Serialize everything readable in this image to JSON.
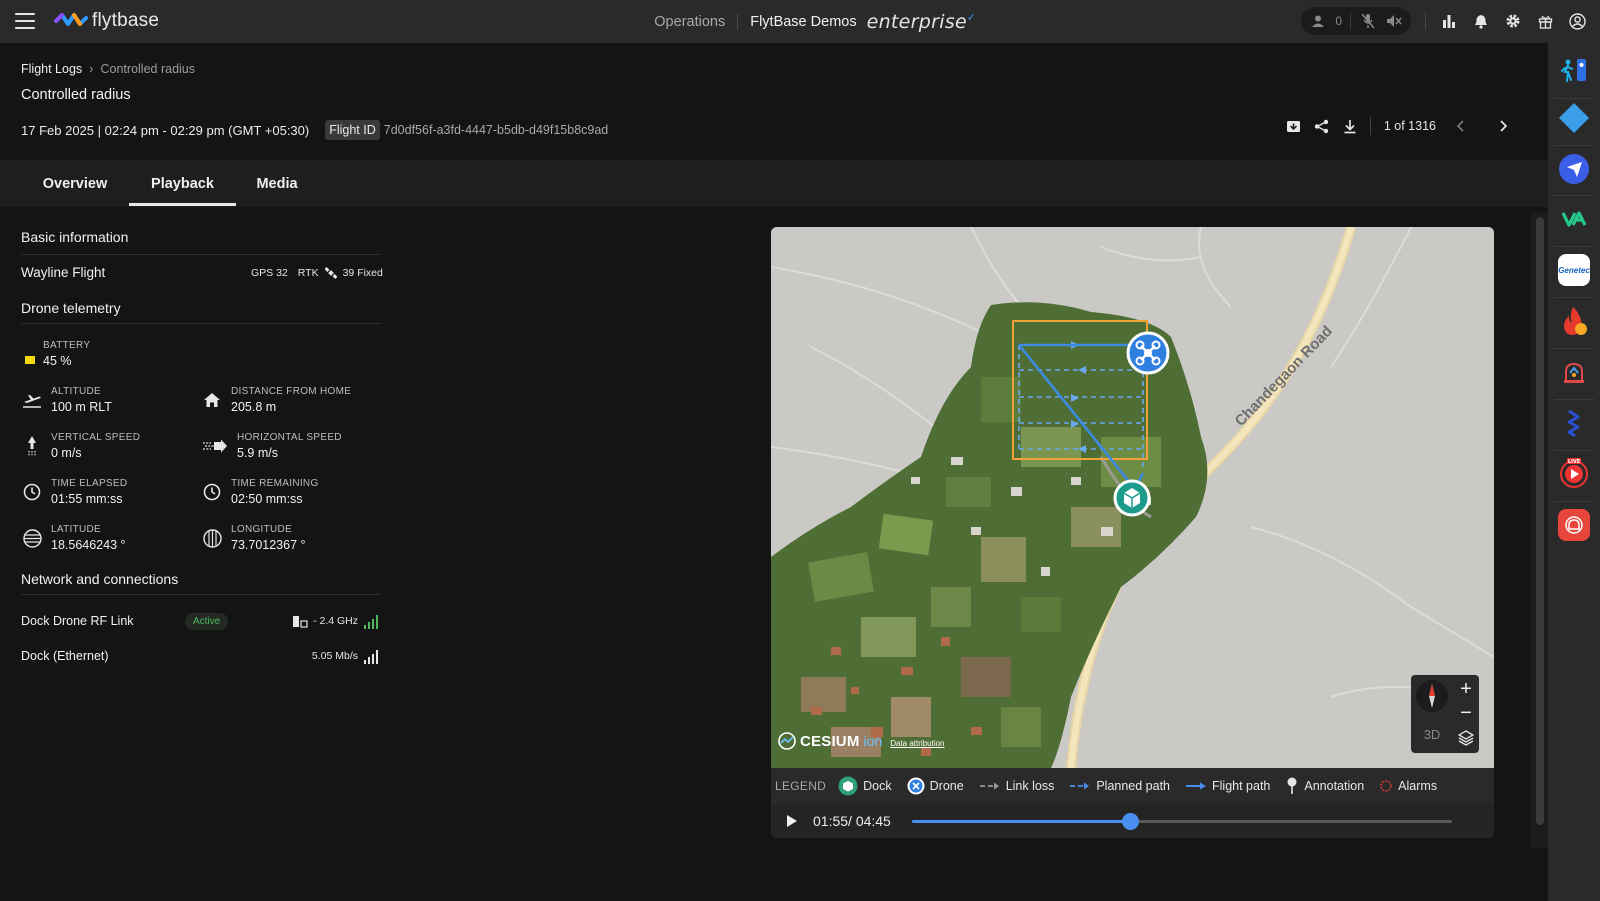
{
  "app": {
    "logo_text": "flytbase"
  },
  "topnav": {
    "operations": "Operations",
    "org": "FlytBase Demos",
    "edition": "enterprise",
    "user_count": "0"
  },
  "breadcrumb": {
    "root": "Flight Logs",
    "current": "Controlled radius"
  },
  "flight": {
    "title": "Controlled radius",
    "datetime": "17 Feb 2025 | 02:24 pm - 02:29 pm (GMT +05:30)",
    "id_label": "Flight ID",
    "id_value": "7d0df56f-a3fd-4447-b5db-d49f15b8c9ad",
    "pager": "1 of 1316"
  },
  "tabs": [
    {
      "label": "Overview"
    },
    {
      "label": "Playback"
    },
    {
      "label": "Media"
    }
  ],
  "basic_info": {
    "title": "Basic information",
    "flight_type": "Wayline Flight",
    "gps": "GPS 32",
    "rtk": "RTK",
    "rtk_value": "39 Fixed"
  },
  "telemetry": {
    "title": "Drone telemetry",
    "battery_label": "BATTERY",
    "battery_value": "45 %",
    "battery_level": 0.45,
    "altitude_label": "ALTITUDE",
    "altitude_value": "100 m RLT",
    "distance_label": "DISTANCE FROM HOME",
    "distance_value": "205.8 m",
    "vspeed_label": "VERTICAL SPEED",
    "vspeed_value": "0 m/s",
    "hspeed_label": "HORIZONTAL SPEED",
    "hspeed_value": "5.9 m/s",
    "elapsed_label": "TIME ELAPSED",
    "elapsed_value": "01:55 mm:ss",
    "remaining_label": "TIME REMAINING",
    "remaining_value": "02:50 mm:ss",
    "lat_label": "LATITUDE",
    "lat_value": "18.5646243 °",
    "lon_label": "LONGITUDE",
    "lon_value": "73.7012367 °"
  },
  "network": {
    "title": "Network and connections",
    "rf_name": "Dock Drone RF Link",
    "rf_status": "Active",
    "rf_band": "- 2.4 GHz",
    "eth_name": "Dock (Ethernet)",
    "eth_speed": "5.05 Mb/s"
  },
  "map": {
    "road_label": "Chandegaon Road",
    "attribution_brand": "CESIUM",
    "attribution_ion": "ion",
    "attribution_link": "Data attribution",
    "mode_3d": "3D"
  },
  "legend": {
    "title": "LEGEND",
    "dock": "Dock",
    "drone": "Drone",
    "link_loss": "Link loss",
    "planned_path": "Planned path",
    "flight_path": "Flight path",
    "annotation": "Annotation",
    "alarms": "Alarms"
  },
  "player": {
    "time": "01:55/ 04:45",
    "progress": 0.4035
  },
  "colors": {
    "accent": "#4a8ff0",
    "active_green": "#4db85c",
    "battery_yellow": "#f5d90a",
    "planned_orange": "#f0a23a"
  }
}
